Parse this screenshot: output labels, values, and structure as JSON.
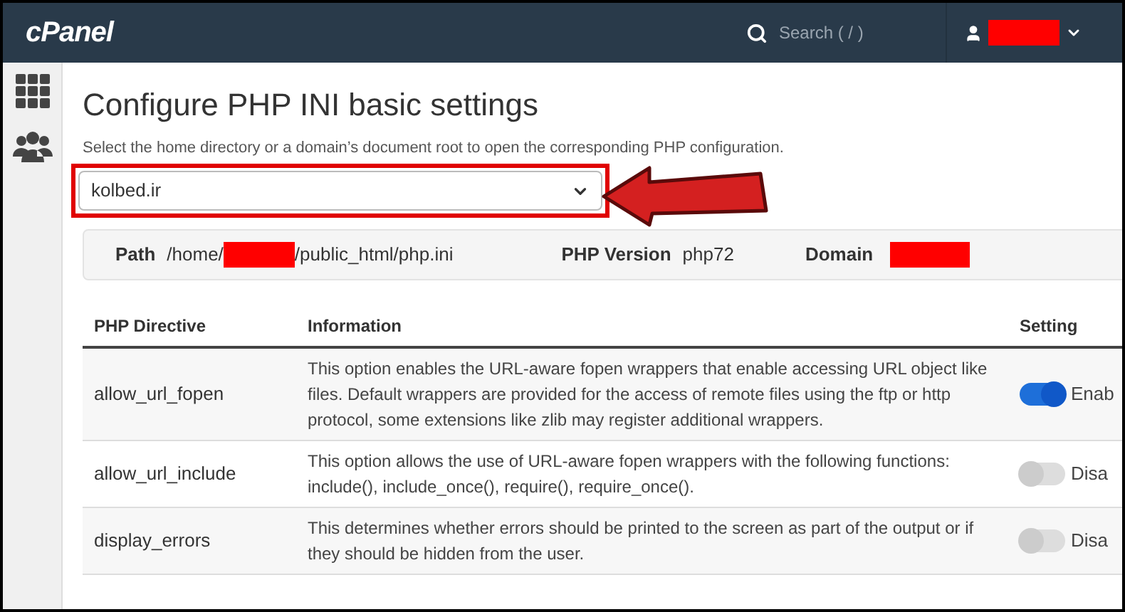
{
  "topbar": {
    "logo": "cPanel",
    "search_placeholder": "Search ( / )"
  },
  "page": {
    "title": "Configure PHP INI basic settings",
    "description": "Select the home directory or a domain’s document root to open the corresponding PHP configuration.",
    "select_value": "kolbed.ir"
  },
  "info": {
    "path_label": "Path",
    "path_start": "/home/",
    "path_end": "/public_html/php.ini",
    "version_label": "PHP Version",
    "version_value": "php72",
    "domain_label": "Domain"
  },
  "table": {
    "columns": [
      "PHP Directive",
      "Information",
      "Setting"
    ],
    "rows": [
      {
        "directive": "allow_url_fopen",
        "information": "This option enables the URL-aware fopen wrappers that enable accessing URL object like files. Default wrappers are provided for the access of remote files using the ftp or http protocol, some extensions like zlib may register additional wrappers.",
        "on": true,
        "setting": "Enab"
      },
      {
        "directive": "allow_url_include",
        "information": "This option allows the use of URL-aware fopen wrappers with the following functions: include(), include_once(), require(), require_once().",
        "on": false,
        "setting": "Disa"
      },
      {
        "directive": "display_errors",
        "information": "This determines whether errors should be printed to the screen as part of the output or if they should be hidden from the user.",
        "on": false,
        "setting": "Disa"
      }
    ]
  }
}
